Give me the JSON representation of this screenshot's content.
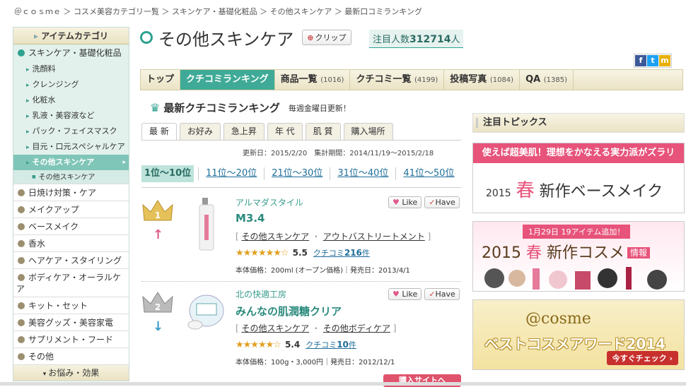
{
  "breadcrumb": "＠ｃｏｓｍｅ ＞ コスメ美容カテゴリ一覧 ＞ スキンケア・基礎化粧品 ＞ その他スキンケア ＞ 最新口コミランキング",
  "sidebar": {
    "header": "アイテムカテゴリ",
    "open_category": "スキンケア・基礎化粧品",
    "sub_items": [
      "洗顔料",
      "クレンジング",
      "化粧水",
      "乳液・美容液など",
      "パック・フェイスマスク",
      "目元・口元スペシャルケア"
    ],
    "active_sub": "その他スキンケア",
    "active_subsub": "その他スキンケア",
    "categories": [
      "日焼け対策・ケア",
      "メイクアップ",
      "ベースメイク",
      "香水",
      "ヘアケア・スタイリング",
      "ボディケア・オーラルケア",
      "キット・セット",
      "美容グッズ・美容家電",
      "サプリメント・フード",
      "その他"
    ],
    "last": "お悩み・効果"
  },
  "page": {
    "title": "その他スキンケア",
    "clip_label": "クリップ",
    "watch_label": "注目人数",
    "watch_count": "312714",
    "watch_unit": "人"
  },
  "tabs": [
    {
      "label": "トップ",
      "count": ""
    },
    {
      "label": "クチコミランキング",
      "count": ""
    },
    {
      "label": "商品一覧",
      "count": "(1016)"
    },
    {
      "label": "クチコミ一覧",
      "count": "(4199)"
    },
    {
      "label": "投稿写真",
      "count": "(1084)"
    },
    {
      "label": "QA",
      "count": "(1385)"
    }
  ],
  "ranking": {
    "title": "最新クチコミランキング",
    "note": "毎週金曜日更新！",
    "subtabs": [
      "最 新",
      "お好み",
      "急上昇",
      "年 代",
      "肌 質",
      "購入場所"
    ],
    "updated": "更新日：2015/2/20",
    "period": "集計期間：2014/11/19〜2015/2/18",
    "pages": [
      "1位〜10位",
      "11位〜20位",
      "21位〜30位",
      "31位〜40位",
      "41位〜50位"
    ]
  },
  "items": [
    {
      "rank": "1",
      "brand": "アルマダスタイル",
      "name": "M3.4",
      "cat1": "その他スキンケア",
      "cat2": "アウトバストリートメント",
      "stars": "★★★★★★☆",
      "score": "5.5",
      "rev_label": "クチコミ",
      "rev_count": "216",
      "rev_unit": "件",
      "price": "本体価格：200ml (オープン価格)",
      "release": "発売日：2013/4/1",
      "like": "Like",
      "have": "Have",
      "arrow": "↑"
    },
    {
      "rank": "2",
      "brand": "北の快適工房",
      "name": "みんなの肌潤糖クリア",
      "cat1": "その他スキンケア",
      "cat2": "その他ボディケア",
      "stars": "★★★★★☆",
      "score": "5.4",
      "rev_label": "クチコミ",
      "rev_count": "10",
      "rev_unit": "件",
      "price": "本体価格：100g・3,000円",
      "release": "発売日：2012/12/1",
      "like": "Like",
      "have": "Have",
      "arrow": "↓"
    }
  ],
  "buy_button": "購入サイトへ",
  "right": {
    "topics_title": "注目トピックス",
    "banner1_bar": "使えば超美肌！理想をかなえる実力派がズラリ",
    "banner1_year": "2015",
    "banner1_spring": "春",
    "banner1_text": "新作ベースメイク",
    "banner2_top": "1月29日 19アイテム追加！",
    "banner2_year": "2015",
    "banner2_spring": "春",
    "banner2_text": "新作コスメ",
    "banner2_tag": "情報",
    "banner3_l1": "@cosme",
    "banner3_l2": "ベストコスメアワード2014",
    "banner3_go": "今すぐチェック ›"
  },
  "colors": {
    "accent": "#3faa97",
    "pink": "#e7537a",
    "star": "#e0a020"
  }
}
